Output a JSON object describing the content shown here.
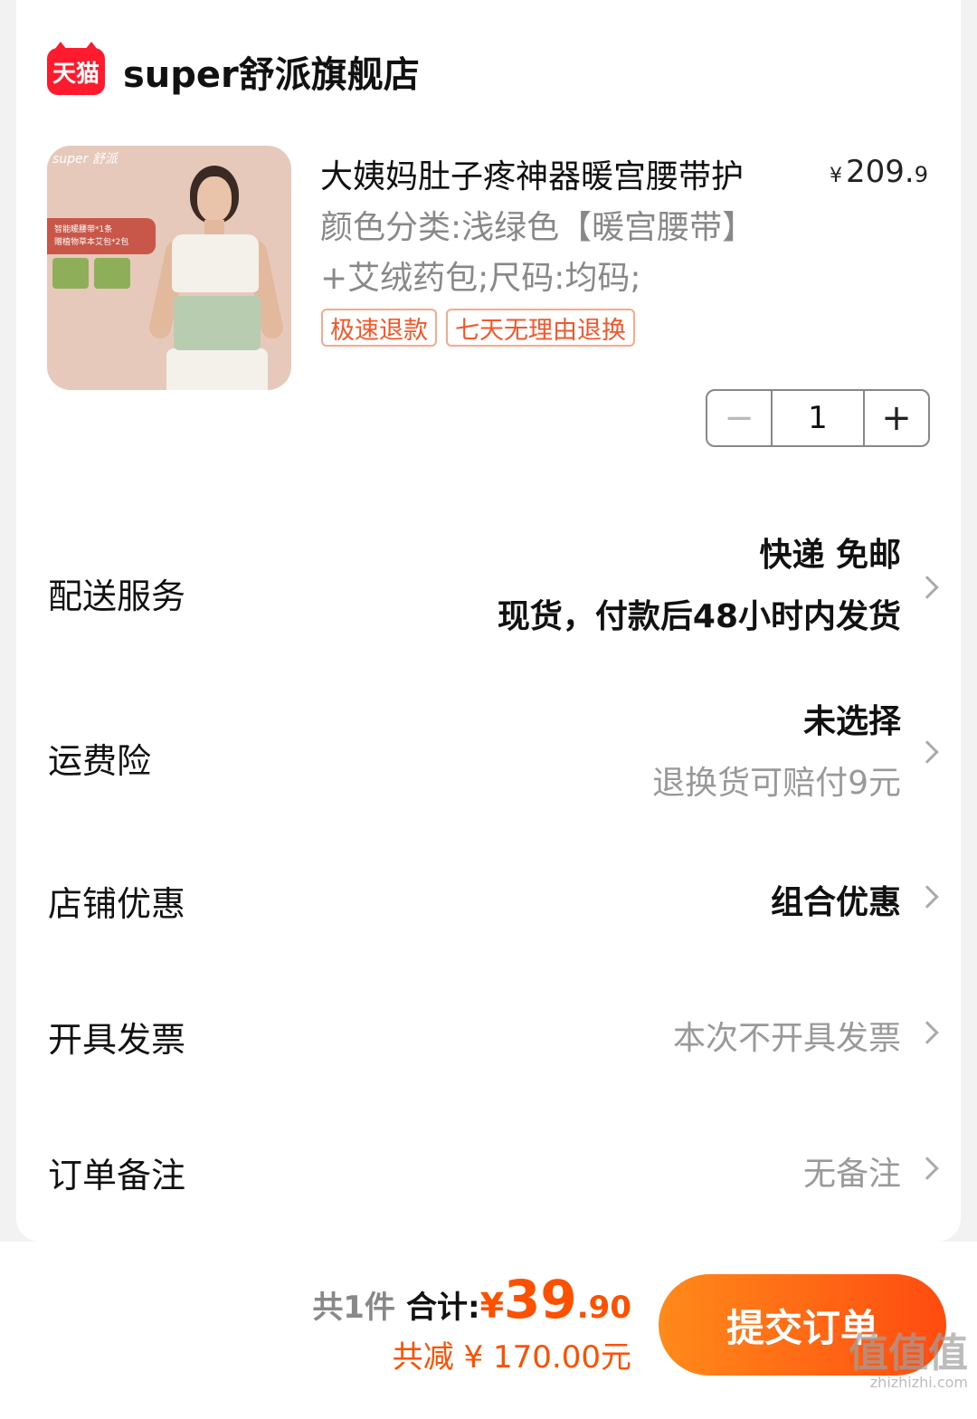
{
  "shop": {
    "logo_text": "天猫",
    "name": "super舒派旗舰店"
  },
  "product": {
    "image_brand": "super 舒派",
    "image_badge_line1": "智能暖腰带*1条",
    "image_badge_line2": "赠植物草本艾包*2包",
    "title": "大姨妈肚子疼神器暖宫腰带护",
    "price_symbol": "¥",
    "price_int": "209.",
    "price_dec": "9",
    "spec": "颜色分类:浅绿色【暖宫腰带】+艾绒药包;尺码:均码;",
    "tags": [
      "极速退款",
      "七天无理由退换"
    ],
    "qty_minus": "−",
    "qty_value": "1",
    "qty_plus": "+"
  },
  "rows": {
    "delivery": {
      "label": "配送服务",
      "line1": "快递 免邮",
      "line2": "现货，付款后48小时内发货"
    },
    "insurance": {
      "label": "运费险",
      "line1": "未选择",
      "line2": "退换货可赔付9元"
    },
    "discount": {
      "label": "店铺优惠",
      "value": "组合优惠"
    },
    "invoice": {
      "label": "开具发票",
      "value": "本次不开具发票"
    },
    "remark": {
      "label": "订单备注",
      "value": "无备注"
    }
  },
  "bottom": {
    "count": "共1件",
    "total_label": "合计:",
    "currency": "¥",
    "total_int": "39",
    "total_dec": ".90",
    "discount": "共减 ¥ 170.00元",
    "submit": "提交订单"
  },
  "watermark": {
    "text": "值值值",
    "site": "zhizhizhi.com"
  },
  "colors": {
    "accent": "#ff5000",
    "tmall_red": "#ff1b2d",
    "tag_border": "#f7a98a"
  }
}
